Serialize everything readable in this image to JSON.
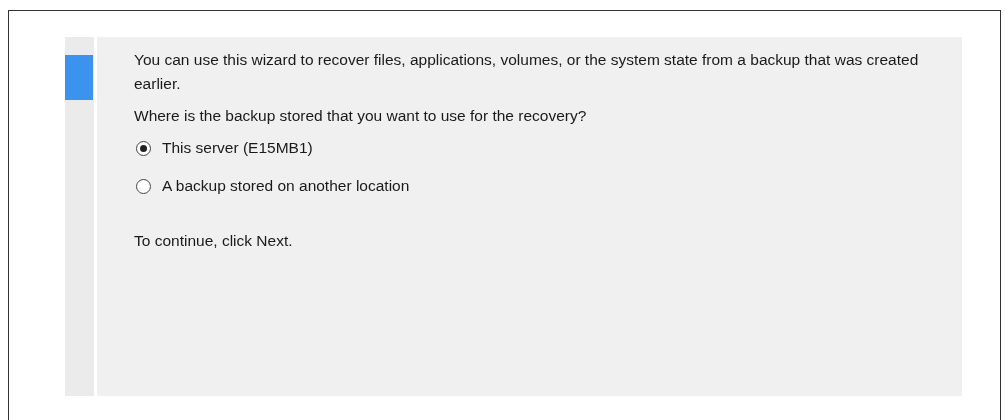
{
  "intro": "You can use this wizard to recover files, applications, volumes, or the system state from a backup that was created earlier.",
  "question": "Where is the backup stored that you want to use for the recovery?",
  "options": [
    {
      "label": "This server (E15MB1)",
      "selected": true
    },
    {
      "label": "A backup stored on another location",
      "selected": false
    }
  ],
  "footer": "To continue, click Next."
}
